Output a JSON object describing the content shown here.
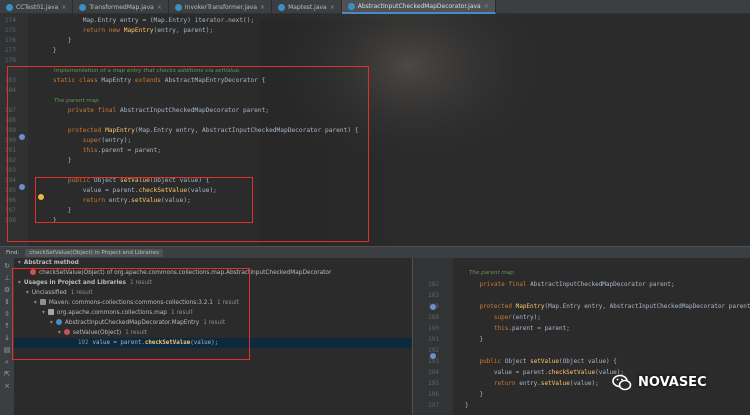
{
  "tabs": [
    {
      "label": "CCTest01.java",
      "active": false
    },
    {
      "label": "TransformedMap.java",
      "active": false
    },
    {
      "label": "InvokerTransformer.java",
      "active": false
    },
    {
      "label": "Maptest.java",
      "active": false
    },
    {
      "label": "AbstractInputCheckedMapDecorator.java",
      "active": true
    }
  ],
  "editor_lines": [
    {
      "num": "174",
      "code": "            Map.Entry entry = (Map.Entry) iterator.next();"
    },
    {
      "num": "175",
      "code": "            return new MapEntry(entry, parent);"
    },
    {
      "num": "176",
      "code": "        }"
    },
    {
      "num": "177",
      "code": "    }"
    },
    {
      "num": "178",
      "code": ""
    },
    {
      "num": "",
      "doc": "Implementation of a map entry that checks additions via setValue."
    },
    {
      "num": "183",
      "code": "    static class MapEntry extends AbstractMapEntryDecorator {"
    },
    {
      "num": "184",
      "code": ""
    },
    {
      "num": "",
      "doc": "The parent map"
    },
    {
      "num": "187",
      "code": "        private final AbstractInputCheckedMapDecorator parent;"
    },
    {
      "num": "188",
      "code": ""
    },
    {
      "num": "189",
      "code": "        protected MapEntry(Map.Entry entry, AbstractInputCheckedMapDecorator parent) {"
    },
    {
      "num": "190",
      "code": "            super(entry);"
    },
    {
      "num": "191",
      "code": "            this.parent = parent;"
    },
    {
      "num": "192",
      "code": "        }"
    },
    {
      "num": "193",
      "code": ""
    },
    {
      "num": "194",
      "code": "        public Object setValue(Object value) {"
    },
    {
      "num": "195",
      "code": "            value = parent.checkSetValue(value);"
    },
    {
      "num": "196",
      "code": "            return entry.setValue(value);"
    },
    {
      "num": "197",
      "code": "        }"
    },
    {
      "num": "198",
      "code": "    }"
    }
  ],
  "find": {
    "label": "Find:",
    "tab": "checkSetValue(Object) in Project and Libraries",
    "rows": [
      {
        "text": "Abstract method",
        "count": ""
      },
      {
        "text": "checkSetValue(Object) of org.apache.commons.collections.map.AbstractInputCheckedMapDecorator",
        "count": ""
      },
      {
        "text": "Usages in Project and Libraries",
        "count": "1 result"
      },
      {
        "text": "Unclassified",
        "count": "1 result"
      },
      {
        "text": "Maven: commons-collections:commons-collections:3.2.1",
        "count": "1 result"
      },
      {
        "text": "org.apache.commons.collections.map",
        "count": "1 result"
      },
      {
        "text": "AbstractInputCheckedMapDecorator.MapEntry",
        "count": "1 result"
      },
      {
        "text": "setValue(Object)",
        "count": "1 result"
      }
    ],
    "selected": {
      "line": "192",
      "before": "value = parent.",
      "match": "checkSetValue",
      "after": "(value);"
    }
  },
  "preview_lines": [
    {
      "num": "",
      "doc": "The parent map"
    },
    {
      "num": "182",
      "code": "    private final AbstractInputCheckedMapDecorator parent;"
    },
    {
      "num": "183",
      "code": ""
    },
    {
      "num": "188",
      "code": "    protected MapEntry(Map.Entry entry, AbstractInputCheckedMapDecorator parent) {"
    },
    {
      "num": "189",
      "code": "        super(entry);"
    },
    {
      "num": "190",
      "code": "        this.parent = parent;"
    },
    {
      "num": "191",
      "code": "    }"
    },
    {
      "num": "192",
      "code": ""
    },
    {
      "num": "193",
      "code": "    public Object setValue(Object value) {"
    },
    {
      "num": "194",
      "code": "        value = parent.checkSetValue(value);"
    },
    {
      "num": "195",
      "code": "        return entry.setValue(value);"
    },
    {
      "num": "196",
      "code": "    }"
    },
    {
      "num": "197",
      "code": "}"
    }
  ],
  "watermark": {
    "label": "NOVASEC"
  },
  "colors": {
    "keyword": "#cc7832",
    "method": "#ffc66d",
    "field": "#9876aa",
    "comment": "#629755",
    "annotation_box": "#e0302a"
  }
}
